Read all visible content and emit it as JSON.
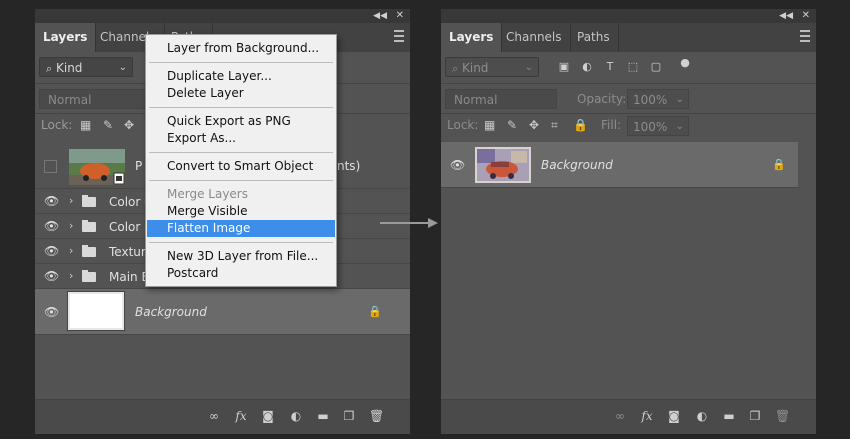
{
  "left_panel": {
    "tabs": [
      "Layers",
      "Channels",
      "Paths"
    ],
    "kind_label": "Kind",
    "blend_mode": "Normal",
    "lock_label": "Lock:",
    "layers": [
      {
        "name": "P",
        "name_suffix": "nts)",
        "kind": "smart-object",
        "visible": false
      },
      {
        "name": "Color C",
        "kind": "group",
        "visible": true
      },
      {
        "name": "Color F",
        "kind": "group",
        "visible": true
      },
      {
        "name": "Textur",
        "kind": "group",
        "visible": true
      },
      {
        "name": "Main E",
        "kind": "group",
        "visible": true
      },
      {
        "name": "Background",
        "kind": "background",
        "visible": true,
        "locked": true,
        "selected": true
      }
    ]
  },
  "context_menu": {
    "groups": [
      [
        "Layer from Background..."
      ],
      [
        "Duplicate Layer...",
        "Delete Layer"
      ],
      [
        "Quick Export as PNG",
        "Export As..."
      ],
      [
        "Convert to Smart Object"
      ],
      [
        "Merge Layers",
        "Merge Visible",
        "Flatten Image"
      ],
      [
        "New 3D Layer from File...",
        "Postcard"
      ]
    ],
    "disabled_item": "Merge Layers",
    "highlighted_item": "Flatten Image",
    "highlight_color": "#3d8ee8"
  },
  "right_panel": {
    "tabs": [
      "Layers",
      "Channels",
      "Paths"
    ],
    "kind_label": "Kind",
    "blend_mode": "Normal",
    "opacity_label": "Opacity:",
    "opacity_value": "100%",
    "lock_label": "Lock:",
    "fill_label": "Fill:",
    "fill_value": "100%",
    "layers": [
      {
        "name": "Background",
        "kind": "background",
        "visible": true,
        "locked": true,
        "selected": true
      }
    ]
  },
  "icons": {
    "close": "close-icon",
    "collapse": "double-chevron-icon",
    "panel_menu": "panel-menu-icon",
    "visibility": "eye-icon",
    "lock": "lock-icon",
    "folder": "folder-icon",
    "bottom": [
      "link-icon",
      "fx-icon",
      "mask-icon",
      "adjustment-icon",
      "folder-icon",
      "new-layer-icon",
      "trash-icon"
    ]
  },
  "colors": {
    "panel": "#535353",
    "selected_row": "#6a6a6a",
    "menu_bg": "#f0f0f0",
    "menu_highlight": "#3d8ee8"
  }
}
